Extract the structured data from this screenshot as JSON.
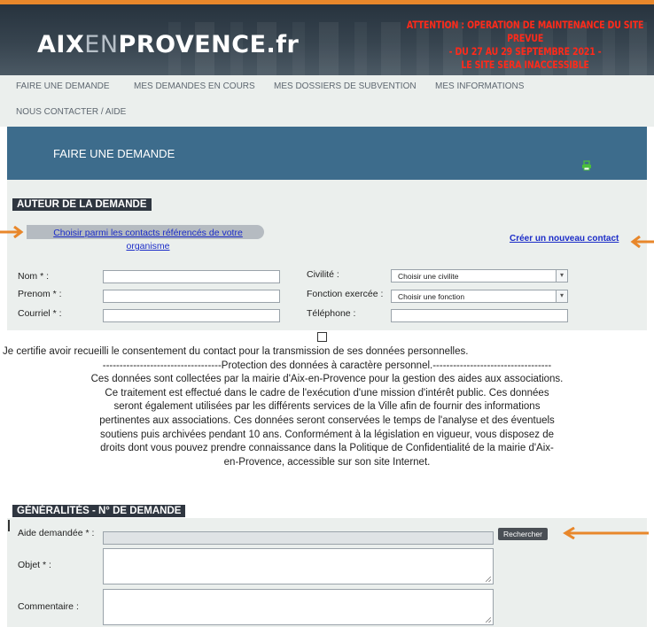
{
  "colors": {
    "accent_orange": "#e8872b",
    "banner_dark": "#27333e",
    "header_blue": "#3d6c8c",
    "warning_red": "#ff2a1a",
    "link_blue": "#1b2cc8",
    "section_bg": "#ebefed"
  },
  "site": {
    "logo_part1": "AIX",
    "logo_part2": "EN",
    "logo_part3": "PROVENCE.fr",
    "maintenance_lines": [
      "ATTENTION : OPERATION DE MAINTENANCE DU SITE PREVUE",
      "- DU 27 AU 29 SEPTEMBRE 2021 -",
      "LE SITE SERA INACCESSIBLE"
    ]
  },
  "nav": {
    "items": [
      "FAIRE UNE DEMANDE",
      "MES DEMANDES EN COURS",
      "MES DOSSIERS DE SUBVENTION",
      "MES INFORMATIONS",
      "NOUS CONTACTER / AIDE"
    ]
  },
  "page": {
    "title": "FAIRE UNE DEMANDE",
    "print_icon": "printer-icon"
  },
  "auteur": {
    "section_title": "AUTEUR DE LA DEMANDE",
    "choose_link": [
      "Choisir parmi les contacts référencés de votre",
      "organisme"
    ],
    "create_link": "Créer un nouveau contact",
    "nom_label": "Nom * :",
    "nom_value": "",
    "prenom_label": "Prenom * :",
    "prenom_value": "",
    "courriel_label": "Courriel * :",
    "courriel_value": "",
    "civilite_label": "Civilité :",
    "civilite_selected": "Choisir une civilite",
    "fonction_label": "Fonction exercée :",
    "fonction_selected": "Choisir une fonction",
    "telephone_label": "Téléphone :",
    "telephone_value": ""
  },
  "consent": {
    "checked": false,
    "line1": "Je certifie avoir recueilli le consentement du contact pour la transmission de ses données personnelles.",
    "line2": "-----------------------------------Protection des données à caractère personnel.-----------------------------------",
    "line3": "Ces données sont collectées par la mairie d'Aix-en-Provence pour la gestion des aides aux associations.",
    "line4": "Ce traitement est effectué dans le cadre de l'exécution d'une mission d'intérêt public. Ces données",
    "line5": "seront également utilisées par les différents services de la Ville afin de fournir des informations",
    "line6": "pertinentes aux associations. Ces données seront conservées le temps de l'analyse et des éventuels",
    "line7": "soutiens puis archivées pendant 10 ans. Conformément à la législation en vigueur, vous disposez de",
    "line8": "droits dont vous pouvez prendre connaissance dans la Politique de Confidentialité de la mairie d'Aix-",
    "line9": "en-Provence, accessible sur son site Internet."
  },
  "generalites": {
    "section_title": "GÉNÉRALITÉS  -  N° DE DEMANDE",
    "aide_label": "Aide demandée * :",
    "aide_value": "",
    "search_button": "Rechercher",
    "objet_label": "Objet * :",
    "objet_value": "",
    "commentaire_label": "Commentaire :",
    "commentaire_value": ""
  }
}
